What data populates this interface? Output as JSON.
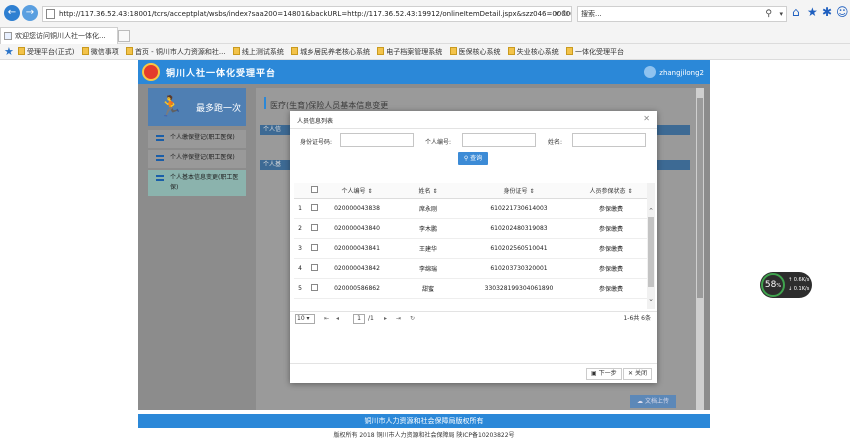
{
  "browser": {
    "url": "http://117.36.52.43:18001/tcrs/acceptplat/wsbs/index?saa200=14801&backURL=http://117.36.52.43:19912/onlineItemDetail.jspx&szz046=00000437&bu",
    "search_placeholder": "搜索...",
    "tab_title": "欢迎您访问铜川人社一体化..."
  },
  "favorites": [
    "受理平台(正式)",
    "微信事项",
    "首页 - 铜川市人力资源和社...",
    "线上测试系统",
    "城乡居民养老核心系统",
    "电子档案管理系统",
    "医保核心系统",
    "失业核心系统",
    "一体化受理平台"
  ],
  "app": {
    "title": "铜川人社一体化受理平台",
    "user": "zhangjilong2"
  },
  "sidebar": {
    "banner": "最多跑一次",
    "items": [
      {
        "label": "个人缴保登记(职工医保)"
      },
      {
        "label": "个人停保登记(职工医保)"
      },
      {
        "label": "个人基本信息变更(职工医保)"
      }
    ]
  },
  "main": {
    "breadcrumb": "医疗(生育)保险人员基本信息变更",
    "section1": "个人信",
    "section2": "个人基",
    "doc_upload": "文档上传"
  },
  "modal": {
    "title": "人员信息列表",
    "id_label": "身份证号码:",
    "pno_label": "个人编号:",
    "name_label": "姓名:",
    "query_label": "查询",
    "columns": [
      "个人编号",
      "姓名",
      "身份证号",
      "人员参保状态"
    ],
    "rows": [
      {
        "idx": "1",
        "pno": "020000043838",
        "name": "席永刚",
        "id": "610221730614003",
        "status": "参保缴费"
      },
      {
        "idx": "2",
        "pno": "020000043840",
        "name": "李木鹏",
        "id": "610202480319083",
        "status": "参保缴费"
      },
      {
        "idx": "3",
        "pno": "020000043841",
        "name": "王建华",
        "id": "610202560510041",
        "status": "参保缴费"
      },
      {
        "idx": "4",
        "pno": "020000043842",
        "name": "李绵瑞",
        "id": "610203730320001",
        "status": "参保缴费"
      },
      {
        "idx": "5",
        "pno": "020000586862",
        "name": "甜蜜",
        "id": "330328199304061890",
        "status": "参保缴费"
      }
    ],
    "pager": {
      "size": "10",
      "page": "1",
      "total_pages": "/1",
      "info": "1-6共 6条"
    },
    "next_label": "下一步",
    "close_label": "关闭"
  },
  "gauge": {
    "percent": "58",
    "unit": "%",
    "up": "0.6",
    "down": "0.1",
    "rate_unit": "K/s"
  },
  "footer": {
    "line1": "铜川市人力资源和社会保障局版权所有",
    "line2": "版权所有 2018 铜川市人力资源和社会保障局 陕ICP备10203822号"
  }
}
